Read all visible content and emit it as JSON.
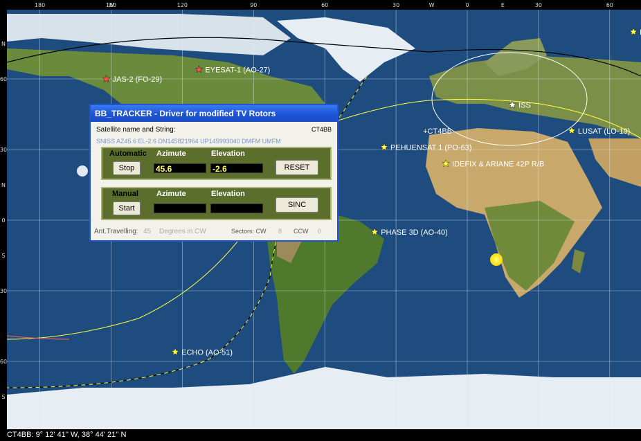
{
  "map": {
    "top_ticks": [
      {
        "label": "180",
        "lon": -180
      },
      {
        "label": "W",
        "lon": -150
      },
      {
        "label": "150",
        "lon": -150
      },
      {
        "label": "120",
        "lon": -120
      },
      {
        "label": "90",
        "lon": -90
      },
      {
        "label": "60",
        "lon": -60
      },
      {
        "label": "30",
        "lon": -30
      },
      {
        "label": "W",
        "lon": -15
      },
      {
        "label": "0",
        "lon": 0
      },
      {
        "label": "E",
        "lon": 15
      },
      {
        "label": "30",
        "lon": 30
      },
      {
        "label": "60",
        "lon": 60
      }
    ],
    "left_ticks": [
      {
        "label": "N",
        "lat": 75
      },
      {
        "label": "60",
        "lat": 60
      },
      {
        "label": "30",
        "lat": 30
      },
      {
        "label": "N",
        "lat": 15
      },
      {
        "label": "0",
        "lat": 0
      },
      {
        "label": "S",
        "lat": -15
      },
      {
        "label": "30",
        "lat": -30
      },
      {
        "label": "60",
        "lat": -60
      },
      {
        "label": "S",
        "lat": -75
      }
    ],
    "satellites": [
      {
        "name": "JAS-2 (FO-29)",
        "color": "#ff5050",
        "lon": -152,
        "lat": 60
      },
      {
        "name": "EYESAT-1 (AO-27)",
        "color": "#ff5050",
        "lon": -113,
        "lat": 64
      },
      {
        "name": "PEHUENSAT 1 (PO-63)",
        "color": "#ffff40",
        "lon": -35,
        "lat": 31
      },
      {
        "name": "IDEFIX & ARIANE 42P R/B",
        "color": "#ffff40",
        "lon": -9,
        "lat": 24
      },
      {
        "name": "ISS",
        "color": "#ffffff",
        "lon": 19,
        "lat": 49
      },
      {
        "name": "LUSAT (LO-19)",
        "color": "#ffff40",
        "lon": 44,
        "lat": 38
      },
      {
        "name": "PHASE 3D (AO-40)",
        "color": "#ffff40",
        "lon": -39,
        "lat": -5
      },
      {
        "name": "ECHO (AO-51)",
        "color": "#ffff40",
        "lon": -123,
        "lat": -56
      },
      {
        "name": "D",
        "color": "#ffff40",
        "lon": 70,
        "lat": 80
      }
    ],
    "station": {
      "name": "CT4BB",
      "lon": -9,
      "lat": 38
    }
  },
  "window": {
    "title": "BB_TRACKER -  Driver for modified  TV Rotors",
    "satellite_label": "Satellite name and String:",
    "callsign": "CT4BB",
    "sat_string": "SNISS AZ45.6 EL-2.6 DN145821964 UP145993040 DMFM UMFM",
    "automatic": {
      "label": "Automatic",
      "azimute_header": "Azimute",
      "elevation_header": "Elevation",
      "button": "Stop",
      "azimute_value": "45.6",
      "elevation_value": "-2.6",
      "reset_button": "RESET"
    },
    "manual": {
      "label": "Manual",
      "azimute_header": "Azimute",
      "elevation_header": "Elevation",
      "button": "Start",
      "azimute_value": "",
      "elevation_value": "",
      "sinc_button": "SINC"
    },
    "bottom": {
      "ant_label": "Ant.Travelling:",
      "ant_value": "45",
      "degrees_label": "Degrees in CW",
      "sectors_label": "Sectors: CW",
      "cw_value": "8",
      "ccw_label": "CCW",
      "ccw_value": "0"
    }
  },
  "status_bar": {
    "text": "CT4BB: 9° 12' 41'' W, 38° 44' 21'' N"
  },
  "colors": {
    "ocean": "#1e4c7e",
    "land": "#6a8a3c",
    "desert": "#c9a96b",
    "ice": "#e6eef4",
    "grid": "#dfe8f0",
    "panel": "#5c6e2c",
    "titlebar": "#1e56d8"
  }
}
